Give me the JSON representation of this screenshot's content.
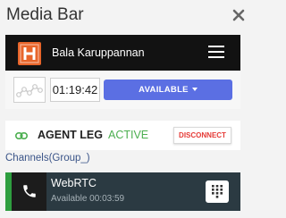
{
  "window": {
    "title": "Media Bar"
  },
  "header": {
    "user_name": "Bala Karuppannan",
    "logo_letter": "H",
    "logo_color": "#e8652a"
  },
  "status": {
    "timer": "01:19:42",
    "availability": "AVAILABLE",
    "availability_color": "#5b6fe3"
  },
  "agent_leg": {
    "label": "AGENT LEG",
    "state": "ACTIVE",
    "state_color": "#4caf50",
    "disconnect_label": "DISCONNECT"
  },
  "channels": {
    "label": "Channels(Group_)"
  },
  "call": {
    "name": "WebRTC",
    "status_text": "Available 00:03:59",
    "indicator_color": "#2e9e3f"
  },
  "icons": [
    "close-icon",
    "logo-icon",
    "menu-icon",
    "chart-icon",
    "caret-down-icon",
    "link-icon",
    "phone-icon",
    "keypad-icon"
  ]
}
